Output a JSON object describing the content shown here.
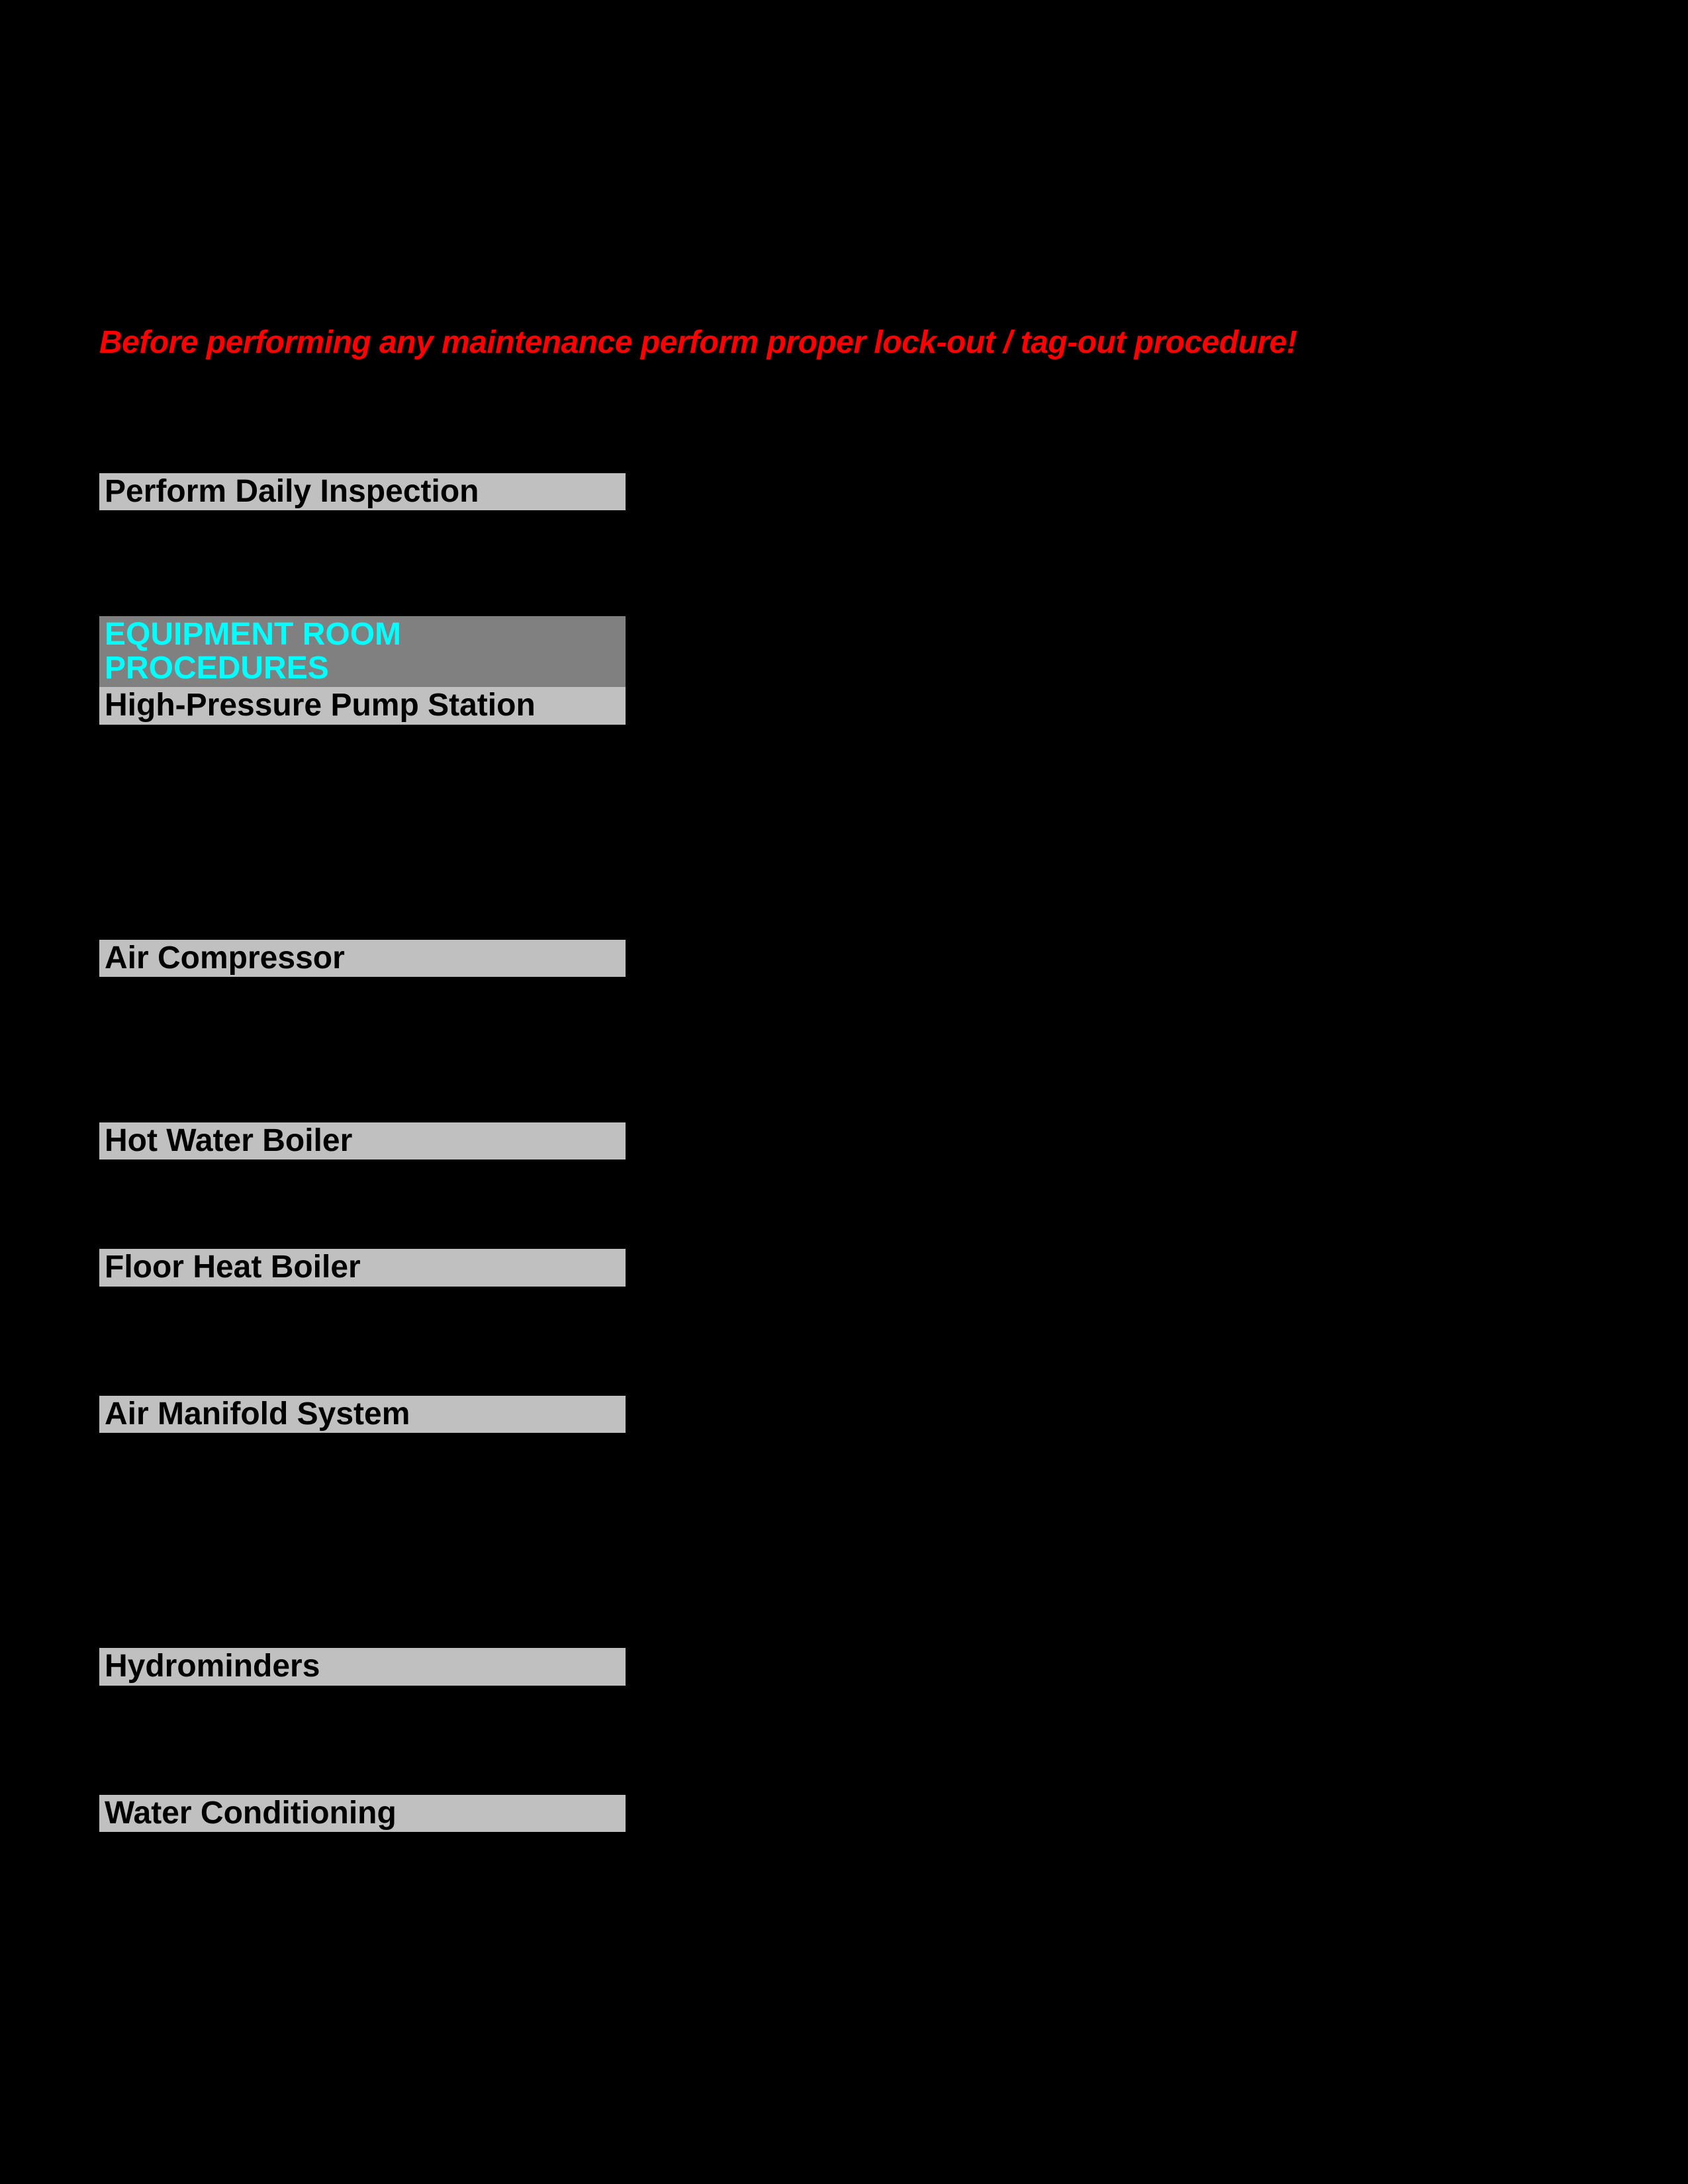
{
  "warning_text": "Before performing any maintenance perform proper lock-out / tag-out procedure!",
  "sections": {
    "s0": "Perform Daily Inspection",
    "s1": "EQUIPMENT ROOM PROCEDURES",
    "s2": "High-Pressure Pump Station",
    "s3": "Air Compressor",
    "s4": "Hot Water Boiler",
    "s5": "Floor Heat Boiler",
    "s6": "Air Manifold System",
    "s7": "Hydrominders",
    "s8": "Water Conditioning"
  }
}
